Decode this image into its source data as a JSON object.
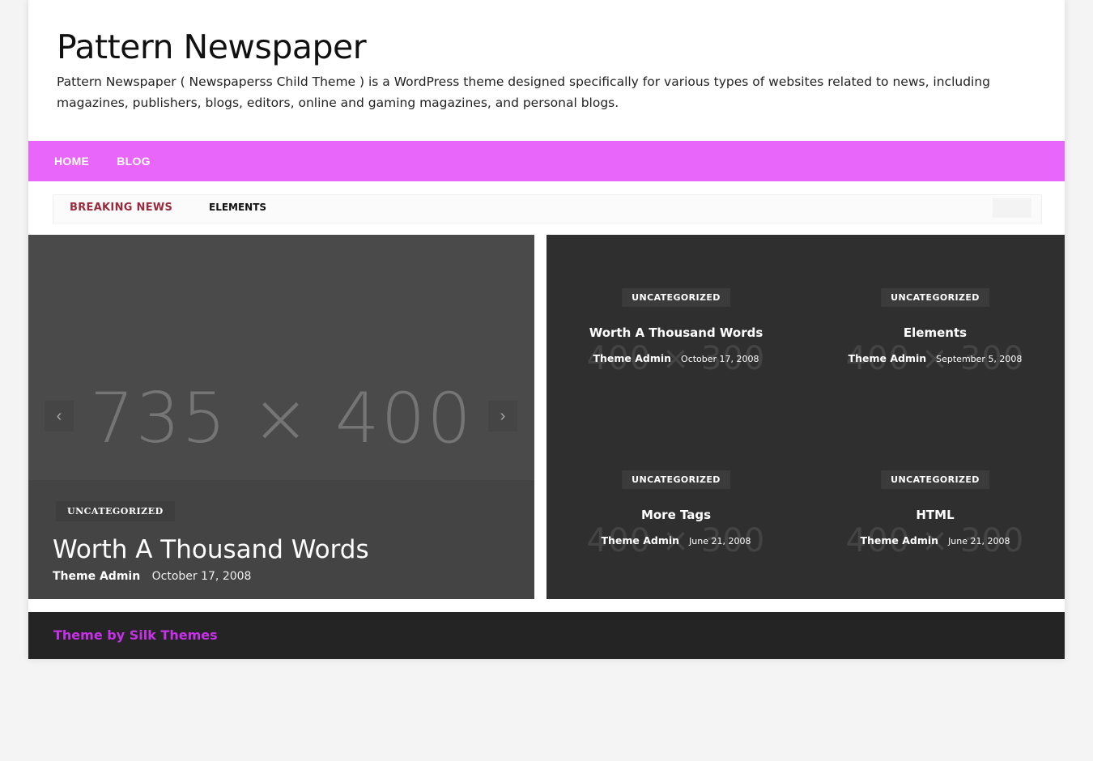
{
  "site": {
    "title": "Pattern Newspaper",
    "description": "Pattern Newspaper ( Newspaperss Child Theme ) is a WordPress theme designed specifically for various types of websites related to news, including magazines, publishers, blogs, editors, online and gaming magazines, and personal blogs."
  },
  "nav": {
    "items": [
      {
        "label": "HOME"
      },
      {
        "label": "BLOG"
      }
    ]
  },
  "ticker": {
    "label": "BREAKING NEWS",
    "item": "ELEMENTS"
  },
  "slider": {
    "placeholder": "735 × 400",
    "category": "UNCATEGORIZED",
    "title": "Worth A Thousand Words",
    "author": "Theme Admin",
    "date": "October 17, 2008",
    "prev_icon": "chevron-left-icon",
    "next_icon": "chevron-right-icon"
  },
  "grid": {
    "cards": [
      {
        "placeholder": "400 × 300",
        "category": "UNCATEGORIZED",
        "title": "Worth A Thousand Words",
        "author": "Theme Admin",
        "date": "October 17, 2008"
      },
      {
        "placeholder": "400 × 300",
        "category": "UNCATEGORIZED",
        "title": "Elements",
        "author": "Theme Admin",
        "date": "September 5, 2008"
      },
      {
        "placeholder": "400 × 300",
        "category": "UNCATEGORIZED",
        "title": "More Tags",
        "author": "Theme Admin",
        "date": "June 21, 2008"
      },
      {
        "placeholder": "400 × 300",
        "category": "UNCATEGORIZED",
        "title": "HTML",
        "author": "Theme Admin",
        "date": "June 21, 2008"
      }
    ]
  },
  "footer": {
    "credit": "Theme by Silk Themes"
  },
  "colors": {
    "nav_bg": "#e866fa",
    "breaking_news": "#9a2a3c",
    "footer_link": "#c731e8",
    "footer_bg": "#242424"
  }
}
